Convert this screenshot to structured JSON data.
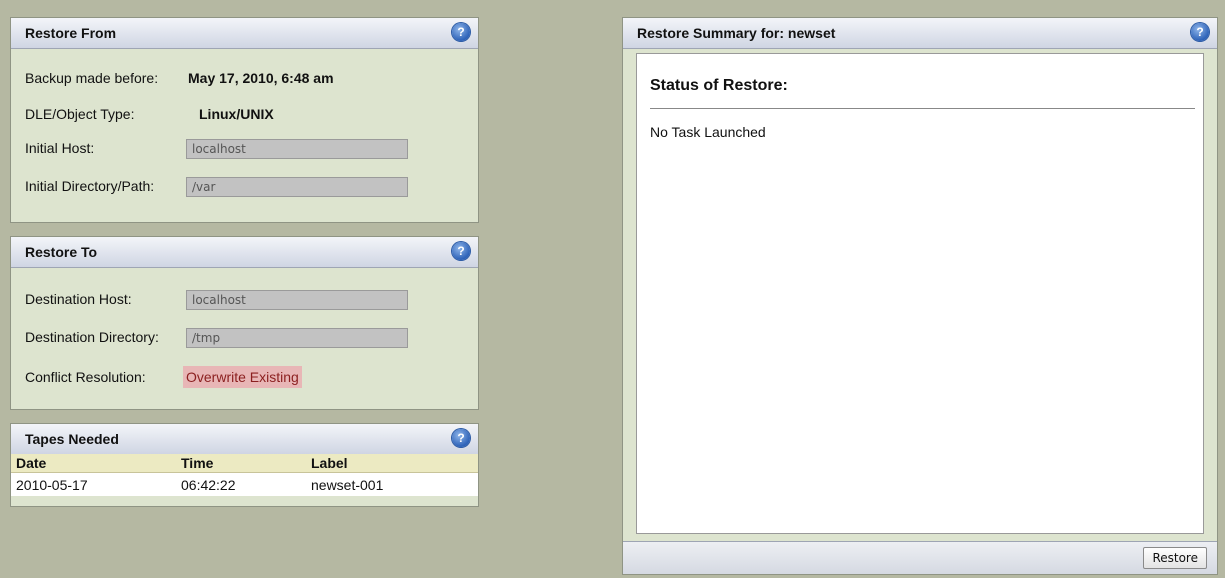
{
  "restore_from": {
    "title": "Restore From",
    "backup_label": "Backup made before:",
    "backup_value": "May 17, 2010, 6:48 am",
    "type_label": "DLE/Object Type:",
    "type_value": "Linux/UNIX",
    "host_label": "Initial Host:",
    "host_value": "localhost",
    "path_label": "Initial Directory/Path:",
    "path_value": "/var"
  },
  "restore_to": {
    "title": "Restore To",
    "dest_host_label": "Destination Host:",
    "dest_host_value": "localhost",
    "dest_dir_label": "Destination Directory:",
    "dest_dir_value": "/tmp",
    "conflict_label": "Conflict Resolution:",
    "conflict_value": "Overwrite Existing"
  },
  "tapes": {
    "title": "Tapes Needed",
    "columns": [
      "Date",
      "Time",
      "Label"
    ],
    "rows": [
      [
        "2010-05-17",
        "06:42:22",
        "newset-001"
      ]
    ]
  },
  "summary": {
    "title": "Restore Summary for: newset",
    "status_heading": "Status of Restore:",
    "status_text": "No Task Launched",
    "restore_button": "Restore"
  },
  "help_glyph": "?",
  "icons": {
    "help": "help-icon"
  },
  "colors": {
    "background": "#b5b8a2",
    "panel": "#dde4cf",
    "conflict_bg": "#e8b6b6",
    "conflict_text": "#8b1f1f",
    "table_header": "#eceac2"
  }
}
